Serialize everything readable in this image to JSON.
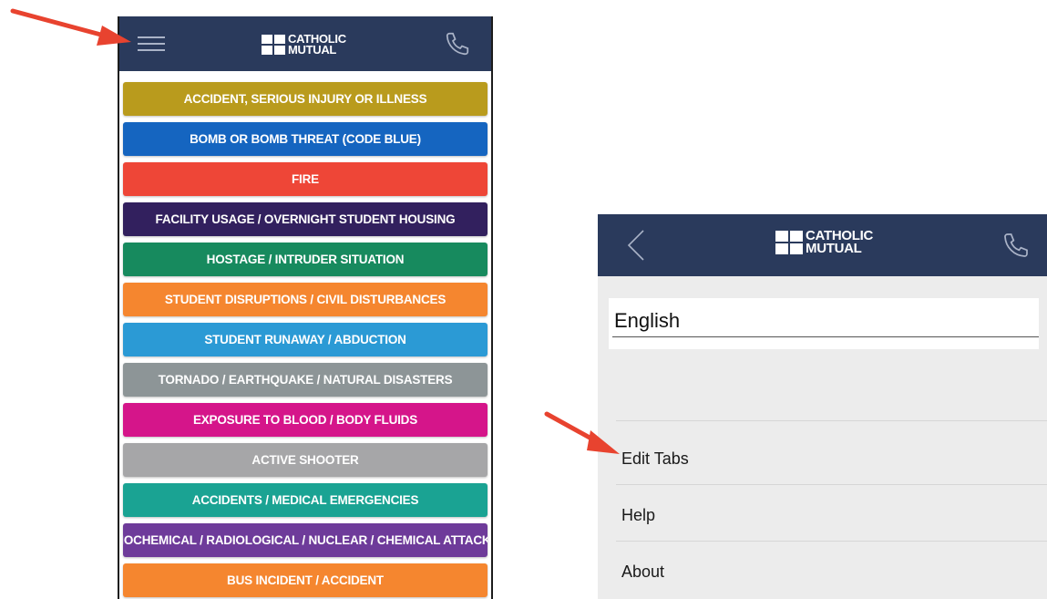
{
  "app": {
    "logo_line1": "CATHOLIC",
    "logo_line2": "MUTUAL"
  },
  "left_screen": {
    "buttons": [
      {
        "label": "ACCIDENT, SERIOUS INJURY OR ILLNESS",
        "color": "#b99b1d"
      },
      {
        "label": "BOMB OR BOMB THREAT (CODE BLUE)",
        "color": "#1565c0"
      },
      {
        "label": "FIRE",
        "color": "#ee4637"
      },
      {
        "label": "FACILITY USAGE / OVERNIGHT STUDENT HOUSING",
        "color": "#32205e"
      },
      {
        "label": "HOSTAGE / INTRUDER SITUATION",
        "color": "#178a5e"
      },
      {
        "label": "STUDENT DISRUPTIONS / CIVIL DISTURBANCES",
        "color": "#f5862f"
      },
      {
        "label": "STUDENT RUNAWAY / ABDUCTION",
        "color": "#2b9ad5"
      },
      {
        "label": "TORNADO / EARTHQUAKE / NATURAL DISASTERS",
        "color": "#8d9597"
      },
      {
        "label": "EXPOSURE TO BLOOD / BODY FLUIDS",
        "color": "#d5158a"
      },
      {
        "label": "ACTIVE SHOOTER",
        "color": "#a6a6a8"
      },
      {
        "label": "ACCIDENTS / MEDICAL EMERGENCIES",
        "color": "#1aa393"
      },
      {
        "label": "BIOCHEMICAL / RADIOLOGICAL / NUCLEAR / CHEMICAL ATTACKS",
        "color": "#6e3b9a"
      },
      {
        "label": "BUS INCIDENT / ACCIDENT",
        "color": "#f5862f"
      }
    ]
  },
  "right_screen": {
    "language_value": "English",
    "menu_items": [
      "Edit Tabs",
      "Help",
      "About"
    ]
  },
  "colors": {
    "header_bg": "#2a3a5c",
    "annotation_arrow": "#e8432f"
  }
}
